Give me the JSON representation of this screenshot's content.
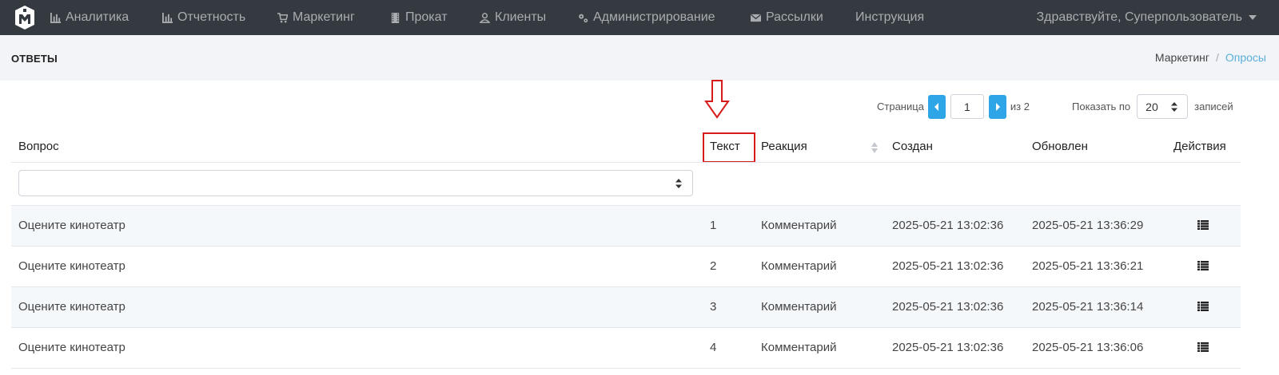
{
  "nav": {
    "items": [
      {
        "label": "Аналитика",
        "icon": "bar-chart-icon"
      },
      {
        "label": "Отчетность",
        "icon": "bar-chart-icon"
      },
      {
        "label": "Маркетинг",
        "icon": "cart-icon"
      },
      {
        "label": "Прокат",
        "icon": "film-icon"
      },
      {
        "label": "Клиенты",
        "icon": "user-icon"
      },
      {
        "label": "Администрирование",
        "icon": "gears-icon"
      },
      {
        "label": "Рассылки",
        "icon": "envelope-icon"
      },
      {
        "label": "Инструкция",
        "icon": ""
      }
    ],
    "user_greeting": "Здравствуйте, Суперпользователь"
  },
  "page": {
    "title": "ОТВЕТЫ",
    "breadcrumb": {
      "parent": "Маркетинг",
      "separator": "/",
      "current": "Опросы"
    }
  },
  "pager": {
    "page_label": "Страница",
    "current_page": "1",
    "of_label": "из 2",
    "show_label": "Показать по",
    "page_size": "20",
    "records_label": "записей"
  },
  "table": {
    "headers": {
      "question": "Вопрос",
      "text": "Текст",
      "reaction": "Реакция",
      "created": "Создан",
      "updated": "Обновлен",
      "actions": "Действия"
    },
    "filter_value": "",
    "rows": [
      {
        "question": "Оцените кинотеатр",
        "text": "1",
        "reaction": "Комментарий",
        "created": "2025-05-21 13:02:36",
        "updated": "2025-05-21 13:36:29"
      },
      {
        "question": "Оцените кинотеатр",
        "text": "2",
        "reaction": "Комментарий",
        "created": "2025-05-21 13:02:36",
        "updated": "2025-05-21 13:36:21"
      },
      {
        "question": "Оцените кинотеатр",
        "text": "3",
        "reaction": "Комментарий",
        "created": "2025-05-21 13:02:36",
        "updated": "2025-05-21 13:36:14"
      },
      {
        "question": "Оцените кинотеатр",
        "text": "4",
        "reaction": "Комментарий",
        "created": "2025-05-21 13:02:36",
        "updated": "2025-05-21 13:36:06"
      }
    ]
  },
  "colors": {
    "topbar": "#343a40",
    "accent": "#2ea5e6",
    "highlight": "#d71b1b",
    "breadcrumb_active": "#5ab0dc"
  }
}
